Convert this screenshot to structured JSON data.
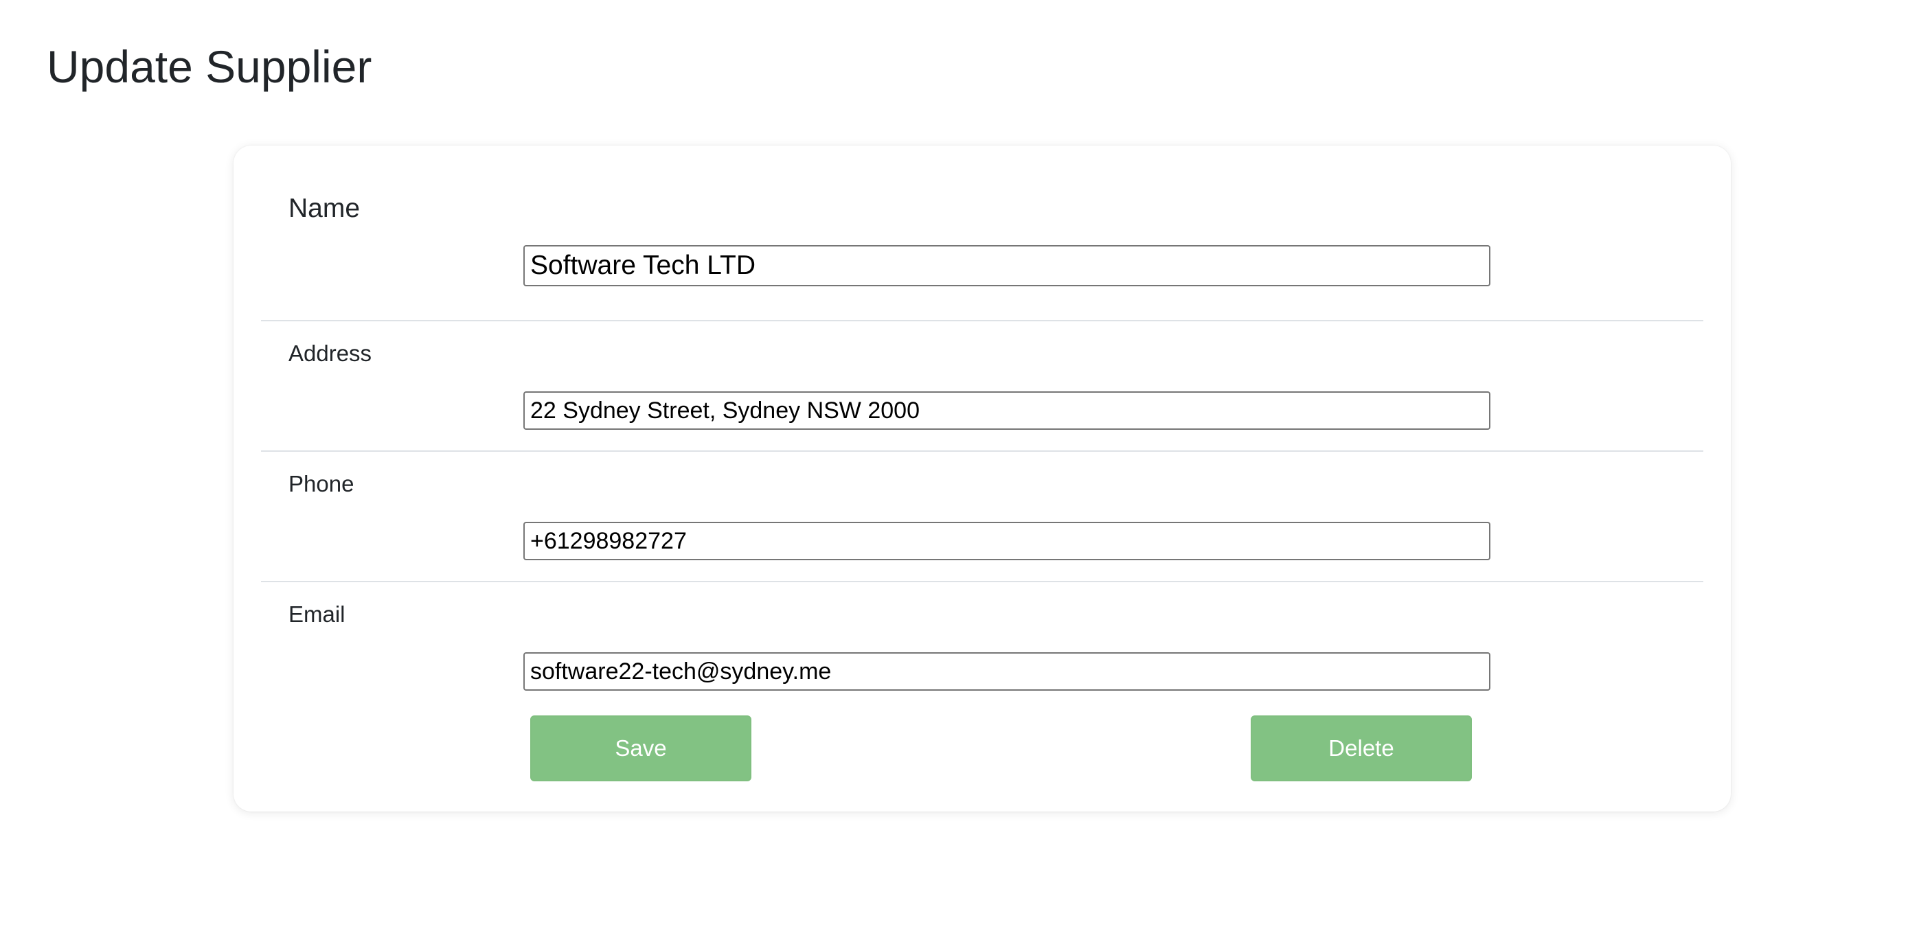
{
  "page": {
    "title": "Update Supplier"
  },
  "form": {
    "name": {
      "label": "Name",
      "value": "Software Tech LTD"
    },
    "address": {
      "label": "Address",
      "value": "22 Sydney Street, Sydney NSW 2000"
    },
    "phone": {
      "label": "Phone",
      "value": "+61298982727"
    },
    "email": {
      "label": "Email",
      "value": "software22-tech@sydney.me"
    }
  },
  "actions": {
    "save_label": "Save",
    "delete_label": "Delete"
  },
  "colors": {
    "button_background": "#82c283",
    "button_text": "#ffffff",
    "divider": "#dee2e6",
    "title_text": "#212529"
  }
}
